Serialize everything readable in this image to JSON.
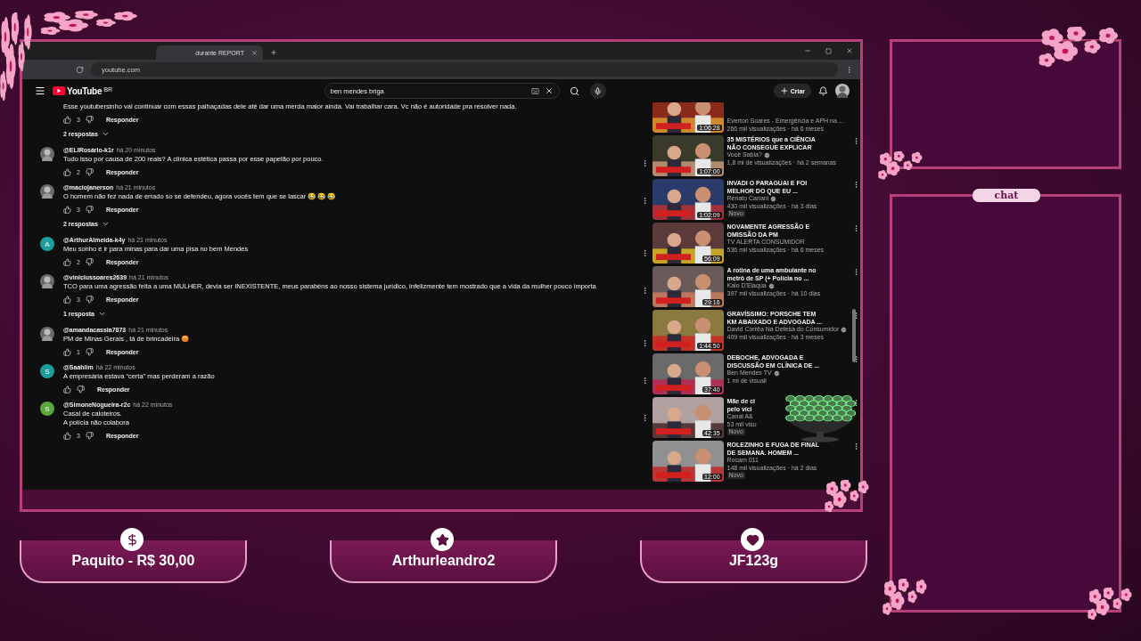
{
  "browser": {
    "tab_title": "durante REPORT",
    "address": "youtube.com"
  },
  "youtube": {
    "logo": "YouTube",
    "region": "BR",
    "search": {
      "value": "ben mendes briga"
    },
    "create_label": "Criar"
  },
  "comments": [
    {
      "text": "Esse youtubersinho vai continuar com essas palhaçadas dele até dar uma merda maior ainda. Vai trabalhar cara. Vc não é autoridade pra resolver nada.",
      "likes": "3",
      "reply_label": "Responder",
      "replies": "2 respostas"
    },
    {
      "author": "@ELIRosário-k1r",
      "time": "há 20 minutos",
      "text": "Tudo isso por causa de 200 reais? A clínica estética passa por esse papelão por pouco.",
      "likes": "2",
      "reply_label": "Responder"
    },
    {
      "author": "@maciojanerson",
      "time": "há 21 minutos",
      "text": "O homem não fez nada de errado so se defendeu, agora vocês tem que se lascar 😂 😂 😂",
      "likes": "3",
      "reply_label": "Responder",
      "replies": "2 respostas"
    },
    {
      "author": "@ArthurAlmeida-k4y",
      "time": "há 21 minutos",
      "avatar": {
        "kind": "letter",
        "letter": "A",
        "color": "#1a9e9e"
      },
      "text": "Meu sonho é ir para minas para dar uma pisa no bem Mendes",
      "likes": "2",
      "reply_label": "Responder"
    },
    {
      "author": "@viniciussoares2639",
      "time": "há 21 minutos",
      "text": "TCO para uma agressão feita a uma MULHER, devia ser INEXISTENTE, meus parabéns ao nosso sistema jurídico, infelizmente tem mostrado que a vida da mulher pouco importa",
      "likes": "3",
      "reply_label": "Responder",
      "replies": "1 resposta"
    },
    {
      "author": "@amandacassia7873",
      "time": "há 21 minutos",
      "text": "PM de Minas Gerais , tá de brincadeira 😡",
      "likes": "1",
      "reply_label": "Responder"
    },
    {
      "author": "@Saahlim",
      "time": "há 22 minutos",
      "avatar": {
        "kind": "letter",
        "letter": "S",
        "color": "#1a9e9e"
      },
      "text": "A empresária estava “certa” mas perderam a razão",
      "reply_label": "Responder"
    },
    {
      "author": "@SimoneNogueira-r2c",
      "time": "há 22 minutos",
      "avatar": {
        "kind": "letter",
        "letter": "S",
        "color": "#5aa83c"
      },
      "text": "Casal de caloteiros.\n A polícia não colabora",
      "likes": "3",
      "reply_label": "Responder"
    }
  ],
  "related": [
    {
      "channel": "Everton Soares - Emergência e APH na ...",
      "views": "266 mil visualizações · há 6 meses",
      "duration": "1:06:28",
      "verified": false,
      "new": false
    },
    {
      "title": [
        "35 MISTÉRIOS que a CIÊNCIA",
        "NÃO CONSEGUE EXPLICAR"
      ],
      "channel": "Você Sabia?",
      "verified": true,
      "views": "1,8 mi de visualizações · há 2 semanas",
      "duration": "1:07:00",
      "new": false
    },
    {
      "title": [
        "INVADI O PARAGUAI E FOI",
        "MELHOR DO QUE EU ..."
      ],
      "channel": "Renato Cariani",
      "verified": true,
      "views": "430 mil visualizações · há 3 dias",
      "duration": "1:02:09",
      "new": true,
      "new_label": "Novo"
    },
    {
      "title": [
        "NOVAMENTE AGRESSÃO E",
        "OMISSÃO DA PM"
      ],
      "channel": "TV ALERTA CONSUMIDOR",
      "verified": false,
      "views": "536 mil visualizações · há 6 meses",
      "duration": "56:09",
      "new": false
    },
    {
      "title": [
        "A rotina de uma ambulante no",
        "metrô de SP (+ Polícia no ..."
      ],
      "channel": "Kaio D'Elaqua",
      "verified": true,
      "views": "397 mil visualizações · há 10 dias",
      "duration": "29:16",
      "new": false
    },
    {
      "title": [
        "GRAVÍSSIMO: PORSCHE TEM",
        "KM ABAIXADO E ADVOGADA ..."
      ],
      "channel": "David Corrêa Na Defesa do Consumidor",
      "verified": true,
      "views": "409 mil visualizações · há 3 meses",
      "duration": "1:44:50",
      "new": false
    },
    {
      "title": [
        "DEBOCHE, ADVOGADA E",
        "DISCUSSÃO EM CLÍNICA DE ..."
      ],
      "channel": "Ben Mendes TV",
      "verified": true,
      "views": "1 mi de visuali",
      "duration": "37:40",
      "new": false
    },
    {
      "title": [
        "Mãe de ci",
        "pelo víci"
      ],
      "channel": "Canal A&",
      "verified": false,
      "views": "53 mil visu",
      "duration": "42:35",
      "new": true,
      "new_label": "Novo"
    },
    {
      "title": [
        "ROLEZINHO E FUGA DE FINAL",
        "DE SEMANA. HOMEM ..."
      ],
      "channel": "Rocam 011",
      "verified": false,
      "views": "148 mil visualizações · há 2 dias",
      "duration": "12:00",
      "new": true,
      "new_label": "Novo"
    }
  ],
  "alerts": [
    {
      "kind": "donation",
      "label": "Paquito - R$ 30,00"
    },
    {
      "kind": "follow",
      "label": "Arthurleandro2"
    },
    {
      "kind": "subscription",
      "label": "JF123g"
    }
  ],
  "chat": {
    "title": "chat"
  }
}
